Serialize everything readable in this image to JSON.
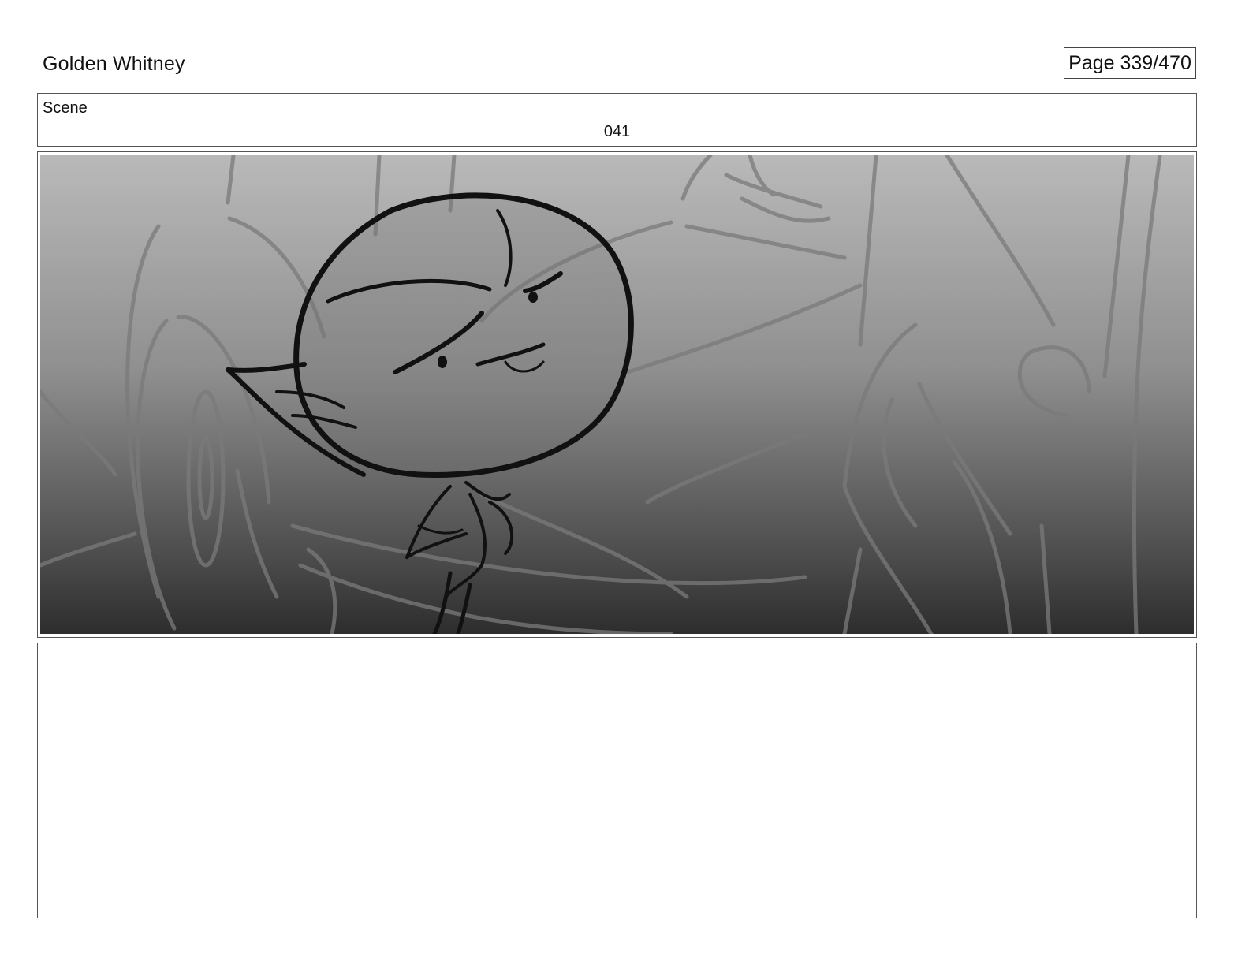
{
  "header": {
    "title": "Golden Whitney",
    "page_label": "Page 339/470"
  },
  "scene": {
    "label": "Scene",
    "number": "041"
  },
  "panel": {
    "illustration": "storyboard-sketch"
  },
  "notes": {
    "text": ""
  }
}
